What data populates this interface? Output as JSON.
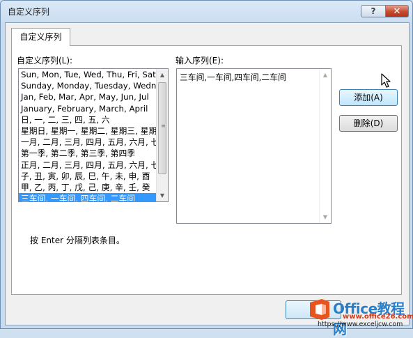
{
  "window": {
    "title": "自定义序列",
    "help_label": "?",
    "close_label": "✕"
  },
  "tab": {
    "label": "自定义序列"
  },
  "lists_label": "自定义序列(L):",
  "entries_label": "输入序列(E):",
  "custom_lists": [
    "Sun, Mon, Tue, Wed, Thu, Fri, Sat",
    "Sunday, Monday, Tuesday, Wednesday",
    "Jan, Feb, Mar, Apr, May, Jun, Jul",
    "January, February, March, April",
    "日, 一, 二, 三, 四, 五, 六",
    "星期日, 星期一, 星期二, 星期三, 星期四",
    "一月, 二月, 三月, 四月, 五月, 六月, 七月",
    "第一季, 第二季, 第三季, 第四季",
    "正月, 二月, 三月, 四月, 五月, 六月, 七月",
    "子, 丑, 寅, 卯, 辰, 巳, 午, 未, 申, 酉",
    "甲, 乙, 丙, 丁, 戊, 己, 庚, 辛, 壬, 癸",
    "三车间, 一车间, 四车间, 二车间"
  ],
  "selected_index": 11,
  "entries_value": "三车间,一车间,四车间,二车间",
  "buttons": {
    "add": "添加(A)",
    "delete": "删除(D)"
  },
  "hint": "按 Enter 分隔列表条目。",
  "watermark": {
    "brand": "Office教程网",
    "url1": "www.office26.com",
    "url2": "https://www.exceljcw.com"
  }
}
